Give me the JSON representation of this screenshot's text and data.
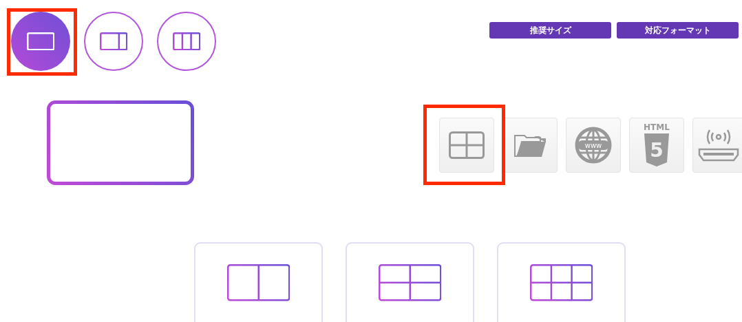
{
  "layout_buttons": [
    {
      "kind": "single",
      "selected": true,
      "highlighted": true
    },
    {
      "kind": "split-2",
      "selected": false,
      "highlighted": false
    },
    {
      "kind": "split-3",
      "selected": false,
      "highlighted": false
    }
  ],
  "header_buttons": [
    "推奨サイズ",
    "対応フォーマット"
  ],
  "preview": {
    "kind": "single"
  },
  "sources": [
    {
      "kind": "grid",
      "highlighted": true
    },
    {
      "kind": "folder",
      "highlighted": false
    },
    {
      "kind": "web",
      "label": "www",
      "highlighted": false
    },
    {
      "kind": "html5",
      "label": "HTML",
      "digit": "5",
      "highlighted": false
    },
    {
      "kind": "hdmi",
      "highlighted": false
    }
  ],
  "layout_cards": [
    {
      "kind": "split-2-even"
    },
    {
      "kind": "grid-4"
    },
    {
      "kind": "grid-6"
    }
  ]
}
